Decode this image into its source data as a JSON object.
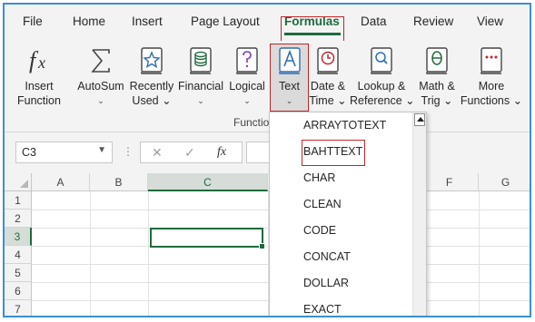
{
  "menu": {
    "tabs": [
      {
        "label": "File"
      },
      {
        "label": "Home"
      },
      {
        "label": "Insert"
      },
      {
        "label": "Page Layout"
      },
      {
        "label": "Formulas"
      },
      {
        "label": "Data"
      },
      {
        "label": "Review"
      },
      {
        "label": "View"
      }
    ],
    "active_tab": "Formulas"
  },
  "ribbon": {
    "insert_function": {
      "line1": "Insert",
      "line2": "Function",
      "icon": "fx-icon"
    },
    "autosum": {
      "line1": "AutoSum",
      "line2": "⌄",
      "icon": "sigma-icon"
    },
    "recently_used": {
      "line1": "Recently",
      "line2": "Used ⌄",
      "icon": "star-book-icon"
    },
    "financial": {
      "line1": "Financial",
      "line2": "⌄",
      "icon": "coins-book-icon"
    },
    "logical": {
      "line1": "Logical",
      "line2": "⌄",
      "icon": "question-book-icon"
    },
    "text": {
      "line1": "Text",
      "line2": "⌄",
      "icon": "text-book-icon"
    },
    "date_time": {
      "line1": "Date &",
      "line2": "Time ⌄",
      "icon": "clock-book-icon"
    },
    "lookup_reference": {
      "line1": "Lookup &",
      "line2": "Reference ⌄",
      "icon": "magnifier-book-icon"
    },
    "math_trig": {
      "line1": "Math &",
      "line2": "Trig ⌄",
      "icon": "theta-book-icon"
    },
    "more_functions": {
      "line1": "More",
      "line2": "Functions ⌄",
      "icon": "dots-book-icon"
    },
    "group_label": "Functio"
  },
  "formula_bar": {
    "name_box": "C3",
    "cancel_glyph": "✕",
    "enter_glyph": "✓",
    "fx_glyph": "fx"
  },
  "grid": {
    "columns": [
      "A",
      "B",
      "C",
      "",
      "F",
      "G"
    ],
    "rows": [
      "1",
      "2",
      "3",
      "4",
      "5",
      "6",
      "7"
    ],
    "selected_cell": "C3"
  },
  "text_dropdown": {
    "items": [
      "ARRAYTOTEXT",
      "BAHTTEXT",
      "CHAR",
      "CLEAN",
      "CODE",
      "CONCAT",
      "DOLLAR",
      "EXACT"
    ],
    "highlighted": "BAHTTEXT"
  },
  "colors": {
    "accent_green": "#1e6b3c",
    "highlight_red": "#c0262a",
    "frame_blue": "#3b8fd4",
    "icon_blue": "#2e6db4",
    "icon_green": "#1e6b3c",
    "icon_purple": "#7a3fb0",
    "icon_red": "#c0262a"
  }
}
